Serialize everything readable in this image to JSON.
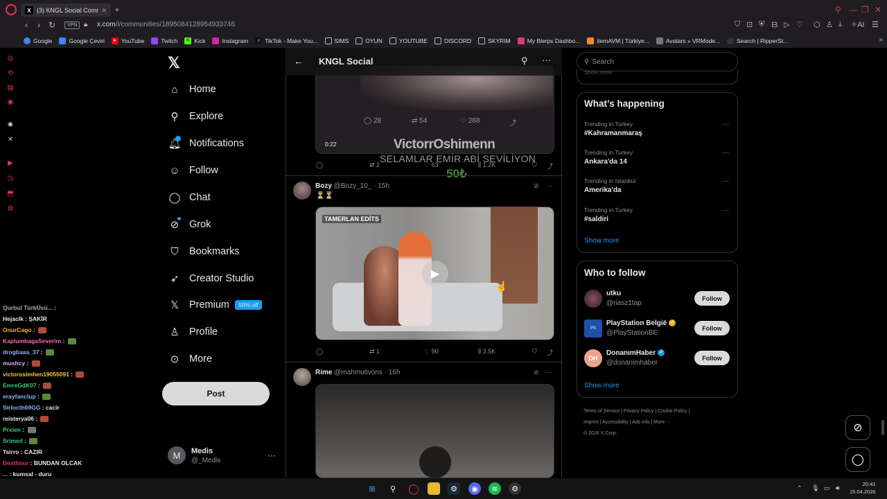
{
  "browser": {
    "tab_title": "(3) KNGL Social Communi",
    "url_host": "x.com",
    "url_path": "/i/communities/1895084128954933746",
    "vpn_label": "VPN",
    "bookmarks": [
      {
        "label": "Google",
        "color": "#4285f4",
        "icon": "google-icon"
      },
      {
        "label": "Google Çeviri",
        "color": "#4285f4",
        "icon": "translate-icon"
      },
      {
        "label": "YouTube",
        "color": "#ff0000",
        "icon": "youtube-icon"
      },
      {
        "label": "Twitch",
        "color": "#9146ff",
        "icon": "twitch-icon"
      },
      {
        "label": "Kick",
        "color": "#53fc18",
        "icon": "kick-icon"
      },
      {
        "label": "Instagram",
        "color": "#d6249f",
        "icon": "instagram-icon"
      },
      {
        "label": "TikTok - Make You...",
        "color": "#111111",
        "icon": "tiktok-icon"
      },
      {
        "label": "SIMS",
        "color": "#555555",
        "icon": "folder-icon"
      },
      {
        "label": "OYUN",
        "color": "#555555",
        "icon": "folder-icon"
      },
      {
        "label": "YOUTUBE",
        "color": "#555555",
        "icon": "folder-icon"
      },
      {
        "label": "DISCORD",
        "color": "#555555",
        "icon": "folder-icon"
      },
      {
        "label": "SKYRIM",
        "color": "#555555",
        "icon": "folder-icon"
      },
      {
        "label": "My Blerps Dashbo...",
        "color": "#e23b6d",
        "icon": "blerp-icon"
      },
      {
        "label": "itemAVM | Türkiye...",
        "color": "#f28c28",
        "icon": "itemavm-icon"
      },
      {
        "label": "Avatars » VRMode...",
        "color": "#777777",
        "icon": "vrmodels-icon"
      },
      {
        "label": "Search | RipperSt...",
        "color": "#222222",
        "icon": "ripper-icon"
      }
    ]
  },
  "chat": [
    {
      "user": "Qurbul TürkÜsü...",
      "color": "#aaaaaa",
      "msg": ""
    },
    {
      "user": "Hejaclk",
      "color": "#e7e9ea",
      "msg": "ŞAKİR"
    },
    {
      "user": "OnurCago",
      "color": "#f5b800",
      "msg": "",
      "emote": "#b04a3a"
    },
    {
      "user": "KaplumbagaSeverim",
      "color": "#ff69b4",
      "msg": "",
      "emote": "#5a8a3a"
    },
    {
      "user": "drogbaaa_37",
      "color": "#8ab4f8",
      "msg": "",
      "emote": "#5a8a3a"
    },
    {
      "user": "mushcy",
      "color": "#d6b3ff",
      "msg": "",
      "emote": "#b04a3a"
    },
    {
      "user": "victorosimhen19055091",
      "color": "#f5c542",
      "msg": "",
      "emote": "#b04a3a"
    },
    {
      "user": "EmreGdK07",
      "color": "#33d17a",
      "msg": "",
      "emote": "#b04a3a"
    },
    {
      "user": "erayfanclup",
      "color": "#8ab4f8",
      "msg": "",
      "emote": "#5a8a3a"
    },
    {
      "user": "Sirlocth69GG",
      "color": "#8ab4f8",
      "msg": "cacir"
    },
    {
      "user": "reisterya06",
      "color": "#e7e9ea",
      "msg": "",
      "emote": "#b04a3a"
    },
    {
      "user": "Prxien",
      "color": "#33d17a",
      "msg": "",
      "emote": "#777777"
    },
    {
      "user": "Srimed",
      "color": "#33d17a",
      "msg": "",
      "emote": "#5a8a3a"
    },
    {
      "user": "Tsirro",
      "color": "#e7e9ea",
      "msg": "CAZIR"
    },
    {
      "user": "Dexthour",
      "color": "#e8364f",
      "msg": "BUNDAN OLCAK"
    },
    {
      "user": "...",
      "color": "#8ab4f8",
      "msg": "kumsal - duru"
    }
  ],
  "nav": {
    "items": [
      {
        "label": "Home",
        "icon": "home-icon",
        "glyph": "⌂"
      },
      {
        "label": "Explore",
        "icon": "search-icon",
        "glyph": "⚲"
      },
      {
        "label": "Notifications",
        "icon": "bell-icon",
        "glyph": "🔔︎"
      },
      {
        "label": "Follow",
        "icon": "add-person-icon",
        "glyph": "☺"
      },
      {
        "label": "Chat",
        "icon": "chat-icon",
        "glyph": "◯"
      },
      {
        "label": "Grok",
        "icon": "grok-icon",
        "glyph": "⊘"
      },
      {
        "label": "Bookmarks",
        "icon": "bookmark-icon",
        "glyph": "⛉"
      },
      {
        "label": "Creator Studio",
        "icon": "rocket-icon",
        "glyph": "➶"
      },
      {
        "label": "Premium",
        "icon": "x-logo-icon",
        "glyph": "𝕏"
      },
      {
        "label": "Profile",
        "icon": "person-icon",
        "glyph": "♙"
      },
      {
        "label": "More",
        "icon": "more-circle-icon",
        "glyph": "⊙"
      }
    ],
    "premium_badge": "50% off",
    "post_label": "Post",
    "me": {
      "initial": "M",
      "name": "Medis",
      "handle": "@_Medis"
    }
  },
  "main": {
    "title": "KNGL Social",
    "post1": {
      "video_stats": {
        "replies": "28",
        "reposts": "54",
        "likes": "268"
      },
      "duration": "0:22",
      "actions": {
        "reposts": "2",
        "likes": "63",
        "views": "1.2K"
      }
    },
    "donation": {
      "name": "VictorrOshimenn",
      "message": "SELAMLAR EMİR ABİ SEVİLİYON",
      "amount": "50₺"
    },
    "post2": {
      "name": "Bozy",
      "handle": "@Bozy_10_",
      "time": "· 15h",
      "text": "⏳⏳",
      "badge": "TAMERLAN EDİTS",
      "actions": {
        "reposts": "1",
        "likes": "90",
        "views": "3.5K"
      }
    },
    "post3": {
      "name": "Rime",
      "handle": "@mahmutivons",
      "time": "· 16h"
    }
  },
  "right": {
    "search_placeholder": "Search",
    "prev_show_more": "Show more",
    "trends_title": "What’s happening",
    "trends": [
      {
        "context": "Trending in Turkey",
        "name": "#Kahramanmaraş"
      },
      {
        "context": "Trending in Turkey",
        "name": "Ankara'da 14"
      },
      {
        "context": "Trending in Istanbul",
        "name": "Amerika'da"
      },
      {
        "context": "Trending in Turkey",
        "name": "#saldiri"
      }
    ],
    "trends_show_more": "Show more",
    "wtf_title": "Who to follow",
    "wtf": [
      {
        "name": "utku",
        "handle": "@riasz1tap",
        "verified": "",
        "avatar_color": "#5a3a4a"
      },
      {
        "name": "PlayStation België",
        "handle": "@PlayStationBE",
        "verified": "gold",
        "avatar_color": "#1f4fa8"
      },
      {
        "name": "DonanımHaber",
        "handle": "@donanimhaber",
        "verified": "blue",
        "avatar_color": "#f0a28a",
        "initials": "DH"
      }
    ],
    "follow_label": "Follow",
    "wtf_show_more": "Show more",
    "footer": {
      "l1": "Terms of Service  |  Privacy Policy  |  Cookie Policy  |",
      "l2": "Imprint  |  Accessibility  |  Ads info  |  More ···",
      "l3": "© 2026 X Corp."
    }
  },
  "taskbar": {
    "time": "20:41",
    "date": "15.04.2026"
  }
}
